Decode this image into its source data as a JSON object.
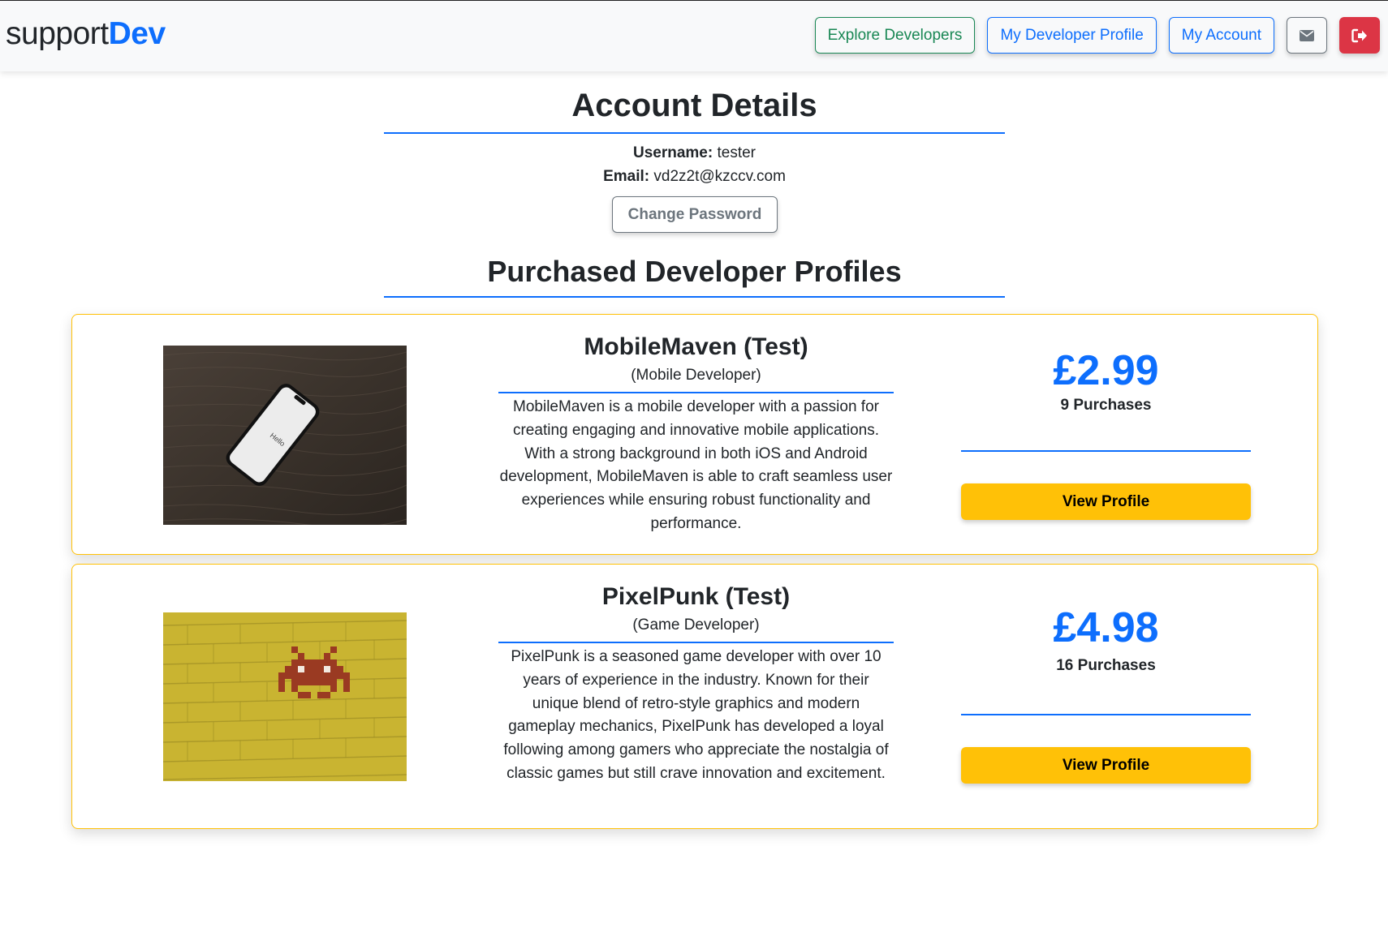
{
  "brand": {
    "part1": "support",
    "part2": "Dev"
  },
  "nav": {
    "explore": "Explore Developers",
    "my_profile": "My Developer Profile",
    "my_account": "My Account",
    "messages_icon": "envelope-icon",
    "logout_icon": "sign-out-icon"
  },
  "account": {
    "title": "Account Details",
    "username_label": "Username:",
    "username": "tester",
    "email_label": "Email:",
    "email": "vd2z2t@kzccv.com",
    "change_password": "Change Password"
  },
  "purchased": {
    "title": "Purchased Developer Profiles",
    "profiles": [
      {
        "name": "MobileMaven (Test)",
        "role": "(Mobile Developer)",
        "description": "MobileMaven is a mobile developer with a passion for creating engaging and innovative mobile applications. With a strong background in both iOS and Android development, MobileMaven is able to craft seamless user experiences while ensuring robust functionality and performance.",
        "price": "£2.99",
        "purchases": "9 Purchases",
        "button": "View Profile",
        "image": "phone-on-wood-image",
        "image_text": "Hello"
      },
      {
        "name": "PixelPunk (Test)",
        "role": "(Game Developer)",
        "description": "PixelPunk is a seasoned game developer with over 10 years of experience in the industry. Known for their unique blend of retro-style graphics and modern gameplay mechanics, PixelPunk has developed a loyal following among gamers who appreciate the nostalgia of classic games but still crave innovation and excitement.",
        "price": "£4.98",
        "purchases": "16 Purchases",
        "button": "View Profile",
        "image": "space-invader-wall-image"
      }
    ]
  },
  "colors": {
    "primary": "#0d6efd",
    "success": "#198754",
    "warning": "#ffc107",
    "danger": "#dc3545",
    "secondary": "#6c757d"
  }
}
